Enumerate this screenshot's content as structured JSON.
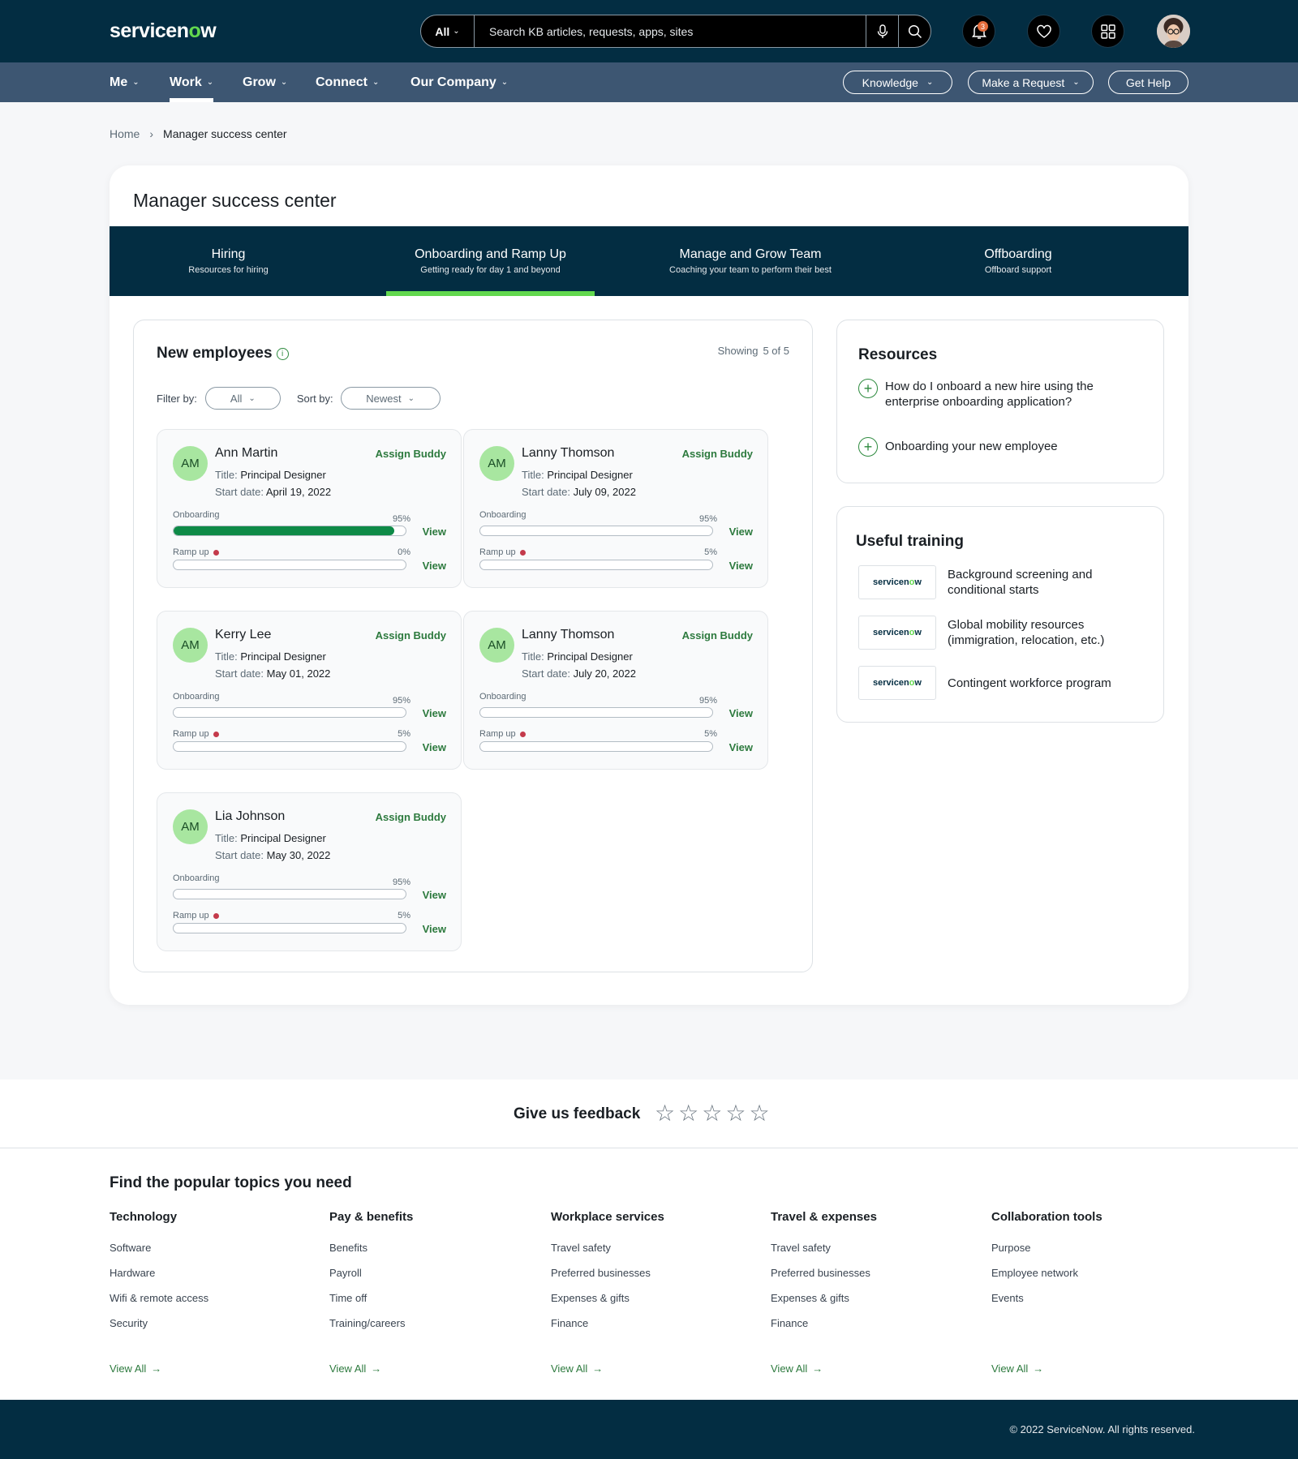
{
  "header": {
    "logo_text_a": "servicen",
    "logo_text_o": "o",
    "logo_text_b": "w",
    "search_scope": "All",
    "search_placeholder": "Search KB articles, requests, apps, sites",
    "notification_count": "3",
    "icons": [
      "microphone-icon",
      "search-icon",
      "bell-icon",
      "heart-icon",
      "grid-icon"
    ]
  },
  "nav": {
    "items": [
      {
        "label": "Me"
      },
      {
        "label": "Work"
      },
      {
        "label": "Grow"
      },
      {
        "label": "Connect"
      },
      {
        "label": "Our Company"
      }
    ],
    "active": "Work",
    "buttons": [
      {
        "label": "Knowledge"
      },
      {
        "label": "Make a Request"
      },
      {
        "label": "Get Help"
      }
    ]
  },
  "breadcrumb": {
    "home": "Home",
    "current": "Manager success center"
  },
  "page": {
    "title": "Manager success center",
    "tabs": [
      {
        "label": "Hiring",
        "sub": "Resources for hiring"
      },
      {
        "label": "Onboarding and Ramp Up",
        "sub": "Getting ready for day 1 and beyond"
      },
      {
        "label": "Manage and Grow Team",
        "sub": "Coaching your team to perform their best"
      },
      {
        "label": "Offboarding",
        "sub": "Offboard support"
      }
    ],
    "active_tab": "Onboarding and Ramp Up"
  },
  "employees": {
    "title": "New employees",
    "showing_label": "Showing",
    "showing_value": "5 of 5",
    "filter_label": "Filter by:",
    "filter_value": "All",
    "sort_label": "Sort by:",
    "sort_value": "Newest",
    "title_prefix": "Title:",
    "start_prefix": "Start date:",
    "onboarding_label": "Onboarding",
    "rampup_label": "Ramp up",
    "view_label": "View",
    "buddy_label": "Assign Buddy",
    "cards": [
      {
        "initials": "AM",
        "name": "Ann Martin",
        "title": "Principal Designer",
        "start": "April 19, 2022",
        "onboarding_pct": "95%",
        "onboarding_value": 95,
        "rampup_pct": "0%",
        "rampup_value": 0
      },
      {
        "initials": "AM",
        "name": "Lanny Thomson",
        "title": "Principal Designer",
        "start": "July 09, 2022",
        "onboarding_pct": "95%",
        "onboarding_value": 0,
        "rampup_pct": "5%",
        "rampup_value": 0
      },
      {
        "initials": "AM",
        "name": "Kerry Lee",
        "title": "Principal Designer",
        "start": "May 01, 2022",
        "onboarding_pct": "95%",
        "onboarding_value": 0,
        "rampup_pct": "5%",
        "rampup_value": 0
      },
      {
        "initials": "AM",
        "name": "Lanny Thomson",
        "title": "Principal Designer",
        "start": "July 20, 2022",
        "onboarding_pct": "95%",
        "onboarding_value": 0,
        "rampup_pct": "5%",
        "rampup_value": 0
      },
      {
        "initials": "AM",
        "name": "Lia Johnson",
        "title": "Principal Designer",
        "start": "May 30, 2022",
        "onboarding_pct": "95%",
        "onboarding_value": 0,
        "rampup_pct": "5%",
        "rampup_value": 0
      }
    ]
  },
  "resources": {
    "title": "Resources",
    "items": [
      {
        "label": "How do I onboard a new hire using the enterprise onboarding application?"
      },
      {
        "label": "Onboarding your new employee"
      }
    ]
  },
  "training": {
    "title": "Useful training",
    "logo_a": "servicen",
    "logo_o": "o",
    "logo_b": "w",
    "items": [
      {
        "label": "Background screening and conditional starts"
      },
      {
        "label": "Global mobility resources (immigration, relocation, etc.)"
      },
      {
        "label": "Contingent workforce program"
      }
    ]
  },
  "feedback": {
    "label": "Give us feedback",
    "stars": 5
  },
  "topics": {
    "title": "Find the popular topics you need",
    "view_all": "View All",
    "columns": [
      {
        "heading": "Technology",
        "links": [
          "Software",
          "Hardware",
          "Wifi & remote access",
          "Security"
        ]
      },
      {
        "heading": "Pay & benefits",
        "links": [
          "Benefits",
          "Payroll",
          "Time off",
          "Training/careers"
        ]
      },
      {
        "heading": "Workplace services",
        "links": [
          "Travel safety",
          "Preferred businesses",
          "Expenses & gifts",
          "Finance"
        ]
      },
      {
        "heading": "Travel & expenses",
        "links": [
          "Travel safety",
          "Preferred businesses",
          "Expenses & gifts",
          "Finance"
        ]
      },
      {
        "heading": "Collaboration tools",
        "links": [
          "Purpose",
          "Employee network",
          "Events"
        ]
      }
    ]
  },
  "footer": {
    "copyright": "© 2022 ServiceNow. All rights reserved."
  },
  "colors": {
    "header_bg": "#032d42",
    "nav_bg": "#3d5672",
    "accent_green": "#62d84e",
    "link_green": "#2d7a3e",
    "progress_fill": "#0e8a47",
    "rampup_dot": "#c43a4b"
  }
}
